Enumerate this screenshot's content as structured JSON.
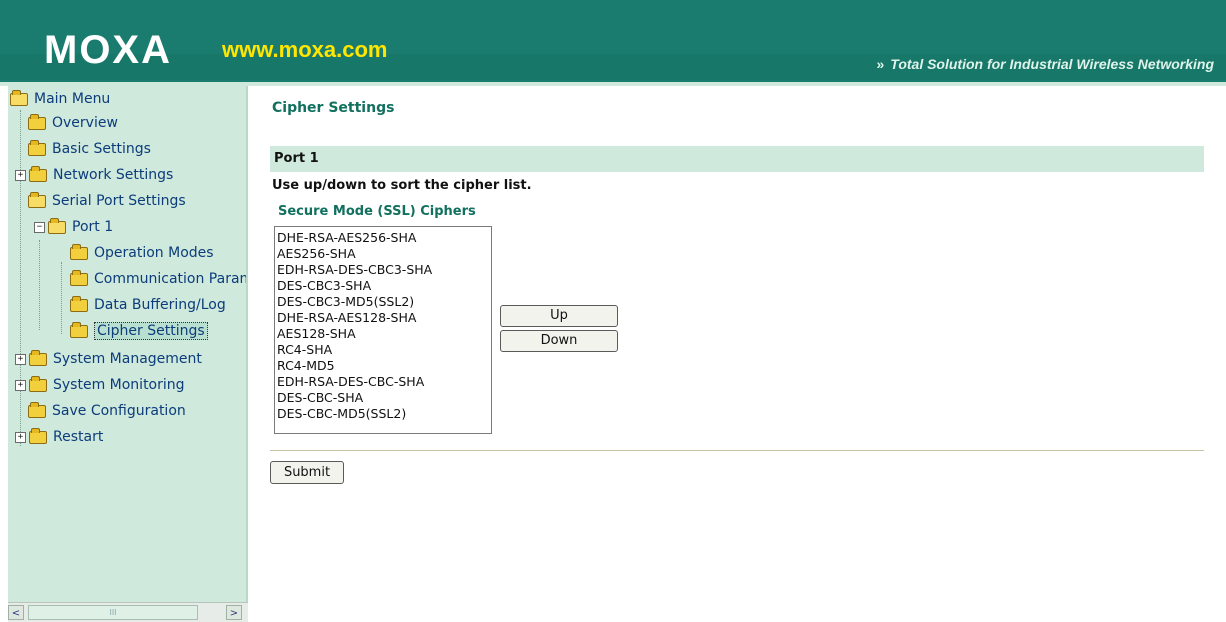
{
  "header": {
    "logo_text": "MOXA",
    "site_url": "www.moxa.com",
    "slogan_arrow": "»",
    "slogan": "Total Solution for Industrial Wireless Networking"
  },
  "sidebar": {
    "root": "Main Menu",
    "items": [
      {
        "label": "Overview"
      },
      {
        "label": "Basic Settings"
      },
      {
        "label": "Network Settings",
        "expand": "+"
      },
      {
        "label": "Serial Port Settings"
      },
      {
        "label": "Port 1",
        "expand": "−"
      },
      {
        "label": "Operation Modes"
      },
      {
        "label": "Communication Parameters"
      },
      {
        "label": "Data Buffering/Log"
      },
      {
        "label": "Cipher Settings",
        "selected": true
      },
      {
        "label": "System Management",
        "expand": "+"
      },
      {
        "label": "System Monitoring",
        "expand": "+"
      },
      {
        "label": "Save Configuration"
      },
      {
        "label": "Restart",
        "expand": "+"
      }
    ],
    "scroll_left": "<",
    "scroll_right": ">",
    "scroll_grip": "III"
  },
  "main": {
    "title": "Cipher Settings",
    "port_label": "Port 1",
    "instruction": "Use up/down to sort the cipher list.",
    "cipher_heading": "Secure Mode (SSL) Ciphers",
    "ciphers": [
      "DHE-RSA-AES256-SHA",
      "AES256-SHA",
      "EDH-RSA-DES-CBC3-SHA",
      "DES-CBC3-SHA",
      "DES-CBC3-MD5(SSL2)",
      "DHE-RSA-AES128-SHA",
      "AES128-SHA",
      "RC4-SHA",
      "RC4-MD5",
      "EDH-RSA-DES-CBC-SHA",
      "DES-CBC-SHA",
      "DES-CBC-MD5(SSL2)"
    ],
    "up_label": "Up",
    "down_label": "Down",
    "submit_label": "Submit"
  },
  "colors": {
    "header_bg": "#1a7c6e",
    "sidebar_bg": "#cfe9dd",
    "accent_text": "#12705f",
    "site_url": "#ffe600"
  }
}
